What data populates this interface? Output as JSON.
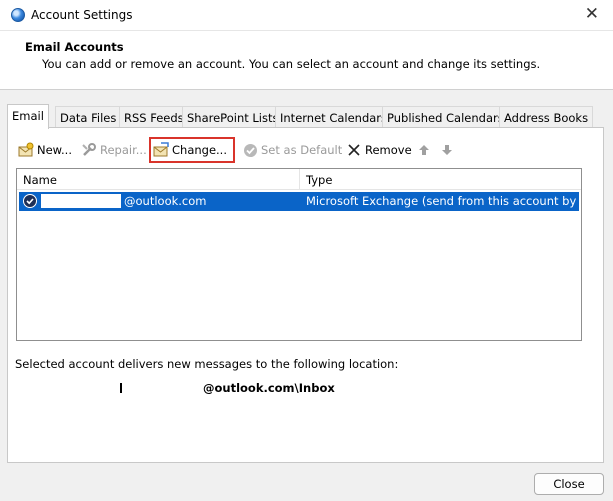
{
  "window": {
    "title": "Account Settings",
    "close_glyph": "✕"
  },
  "header": {
    "title": "Email Accounts",
    "description": "You can add or remove an account. You can select an account and change its settings."
  },
  "tabs": [
    {
      "label": "Email",
      "active": true
    },
    {
      "label": "Data Files"
    },
    {
      "label": "RSS Feeds"
    },
    {
      "label": "SharePoint Lists"
    },
    {
      "label": "Internet Calendars"
    },
    {
      "label": "Published Calendars"
    },
    {
      "label": "Address Books"
    }
  ],
  "toolbar": {
    "new_label": "New...",
    "repair_label": "Repair...",
    "change_label": "Change...",
    "set_default_label": "Set as Default",
    "remove_label": "Remove",
    "highlight_color": "#d9342b"
  },
  "accounts": {
    "columns": {
      "name": "Name",
      "type": "Type"
    },
    "rows": [
      {
        "name": "@outlook.com",
        "type": "Microsoft Exchange (send from this account by def..."
      }
    ],
    "selected_color": "#0a64c8"
  },
  "delivery": {
    "label": "Selected account delivers new messages to the following location:",
    "location": "@outlook.com\\Inbox"
  },
  "footer": {
    "close_label": "Close"
  }
}
